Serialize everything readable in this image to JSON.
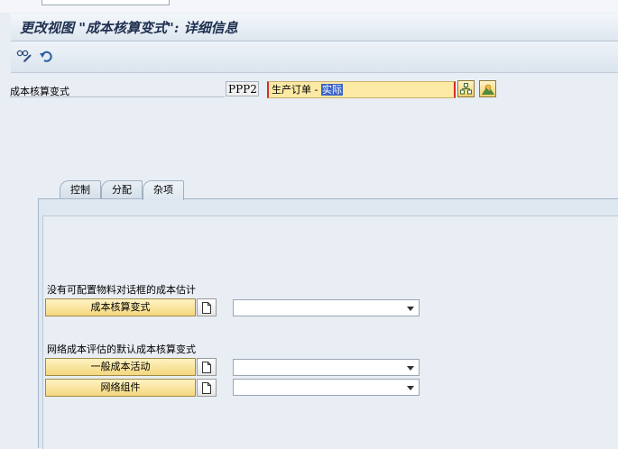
{
  "window": {
    "title": "更改视图 \"成本核算变式\": 详细信息"
  },
  "toolbar": {
    "items": [
      "glasses-edit-icon",
      "undo-icon"
    ]
  },
  "header_field": {
    "label": "成本核算变式",
    "code": "PPP2",
    "description_prefix": "生产订单 - ",
    "description_selected": "实际"
  },
  "tabs": [
    {
      "label": "控制",
      "active": false
    },
    {
      "label": "分配",
      "active": false
    },
    {
      "label": "杂项",
      "active": true
    }
  ],
  "sections": [
    {
      "heading": "没有可配置物料对话框的成本估计",
      "rows": [
        {
          "button": "成本核算变式",
          "value": ""
        }
      ]
    },
    {
      "heading": "网络成本评估的默认成本核算变式",
      "rows": [
        {
          "button": "一般成本活动",
          "value": ""
        },
        {
          "button": "网络组件",
          "value": ""
        }
      ]
    }
  ]
}
